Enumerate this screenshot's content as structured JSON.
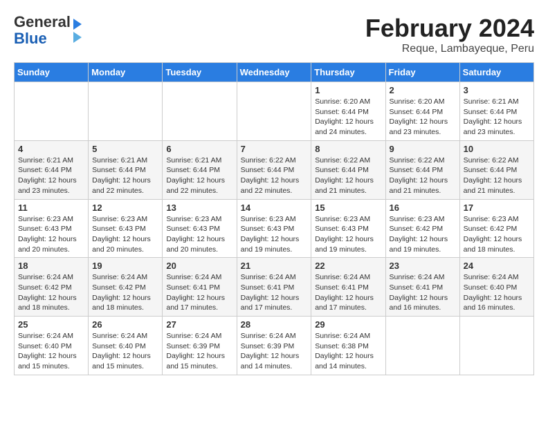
{
  "header": {
    "logo": {
      "general": "General",
      "blue": "Blue"
    },
    "title": "February 2024",
    "subtitle": "Reque, Lambayeque, Peru"
  },
  "calendar": {
    "days_of_week": [
      "Sunday",
      "Monday",
      "Tuesday",
      "Wednesday",
      "Thursday",
      "Friday",
      "Saturday"
    ],
    "weeks": [
      [
        {
          "day": "",
          "info": ""
        },
        {
          "day": "",
          "info": ""
        },
        {
          "day": "",
          "info": ""
        },
        {
          "day": "",
          "info": ""
        },
        {
          "day": "1",
          "info": "Sunrise: 6:20 AM\nSunset: 6:44 PM\nDaylight: 12 hours and 24 minutes."
        },
        {
          "day": "2",
          "info": "Sunrise: 6:20 AM\nSunset: 6:44 PM\nDaylight: 12 hours and 23 minutes."
        },
        {
          "day": "3",
          "info": "Sunrise: 6:21 AM\nSunset: 6:44 PM\nDaylight: 12 hours and 23 minutes."
        }
      ],
      [
        {
          "day": "4",
          "info": "Sunrise: 6:21 AM\nSunset: 6:44 PM\nDaylight: 12 hours and 23 minutes."
        },
        {
          "day": "5",
          "info": "Sunrise: 6:21 AM\nSunset: 6:44 PM\nDaylight: 12 hours and 22 minutes."
        },
        {
          "day": "6",
          "info": "Sunrise: 6:21 AM\nSunset: 6:44 PM\nDaylight: 12 hours and 22 minutes."
        },
        {
          "day": "7",
          "info": "Sunrise: 6:22 AM\nSunset: 6:44 PM\nDaylight: 12 hours and 22 minutes."
        },
        {
          "day": "8",
          "info": "Sunrise: 6:22 AM\nSunset: 6:44 PM\nDaylight: 12 hours and 21 minutes."
        },
        {
          "day": "9",
          "info": "Sunrise: 6:22 AM\nSunset: 6:44 PM\nDaylight: 12 hours and 21 minutes."
        },
        {
          "day": "10",
          "info": "Sunrise: 6:22 AM\nSunset: 6:44 PM\nDaylight: 12 hours and 21 minutes."
        }
      ],
      [
        {
          "day": "11",
          "info": "Sunrise: 6:23 AM\nSunset: 6:43 PM\nDaylight: 12 hours and 20 minutes."
        },
        {
          "day": "12",
          "info": "Sunrise: 6:23 AM\nSunset: 6:43 PM\nDaylight: 12 hours and 20 minutes."
        },
        {
          "day": "13",
          "info": "Sunrise: 6:23 AM\nSunset: 6:43 PM\nDaylight: 12 hours and 20 minutes."
        },
        {
          "day": "14",
          "info": "Sunrise: 6:23 AM\nSunset: 6:43 PM\nDaylight: 12 hours and 19 minutes."
        },
        {
          "day": "15",
          "info": "Sunrise: 6:23 AM\nSunset: 6:43 PM\nDaylight: 12 hours and 19 minutes."
        },
        {
          "day": "16",
          "info": "Sunrise: 6:23 AM\nSunset: 6:42 PM\nDaylight: 12 hours and 19 minutes."
        },
        {
          "day": "17",
          "info": "Sunrise: 6:23 AM\nSunset: 6:42 PM\nDaylight: 12 hours and 18 minutes."
        }
      ],
      [
        {
          "day": "18",
          "info": "Sunrise: 6:24 AM\nSunset: 6:42 PM\nDaylight: 12 hours and 18 minutes."
        },
        {
          "day": "19",
          "info": "Sunrise: 6:24 AM\nSunset: 6:42 PM\nDaylight: 12 hours and 18 minutes."
        },
        {
          "day": "20",
          "info": "Sunrise: 6:24 AM\nSunset: 6:41 PM\nDaylight: 12 hours and 17 minutes."
        },
        {
          "day": "21",
          "info": "Sunrise: 6:24 AM\nSunset: 6:41 PM\nDaylight: 12 hours and 17 minutes."
        },
        {
          "day": "22",
          "info": "Sunrise: 6:24 AM\nSunset: 6:41 PM\nDaylight: 12 hours and 17 minutes."
        },
        {
          "day": "23",
          "info": "Sunrise: 6:24 AM\nSunset: 6:41 PM\nDaylight: 12 hours and 16 minutes."
        },
        {
          "day": "24",
          "info": "Sunrise: 6:24 AM\nSunset: 6:40 PM\nDaylight: 12 hours and 16 minutes."
        }
      ],
      [
        {
          "day": "25",
          "info": "Sunrise: 6:24 AM\nSunset: 6:40 PM\nDaylight: 12 hours and 15 minutes."
        },
        {
          "day": "26",
          "info": "Sunrise: 6:24 AM\nSunset: 6:40 PM\nDaylight: 12 hours and 15 minutes."
        },
        {
          "day": "27",
          "info": "Sunrise: 6:24 AM\nSunset: 6:39 PM\nDaylight: 12 hours and 15 minutes."
        },
        {
          "day": "28",
          "info": "Sunrise: 6:24 AM\nSunset: 6:39 PM\nDaylight: 12 hours and 14 minutes."
        },
        {
          "day": "29",
          "info": "Sunrise: 6:24 AM\nSunset: 6:38 PM\nDaylight: 12 hours and 14 minutes."
        },
        {
          "day": "",
          "info": ""
        },
        {
          "day": "",
          "info": ""
        }
      ]
    ]
  }
}
